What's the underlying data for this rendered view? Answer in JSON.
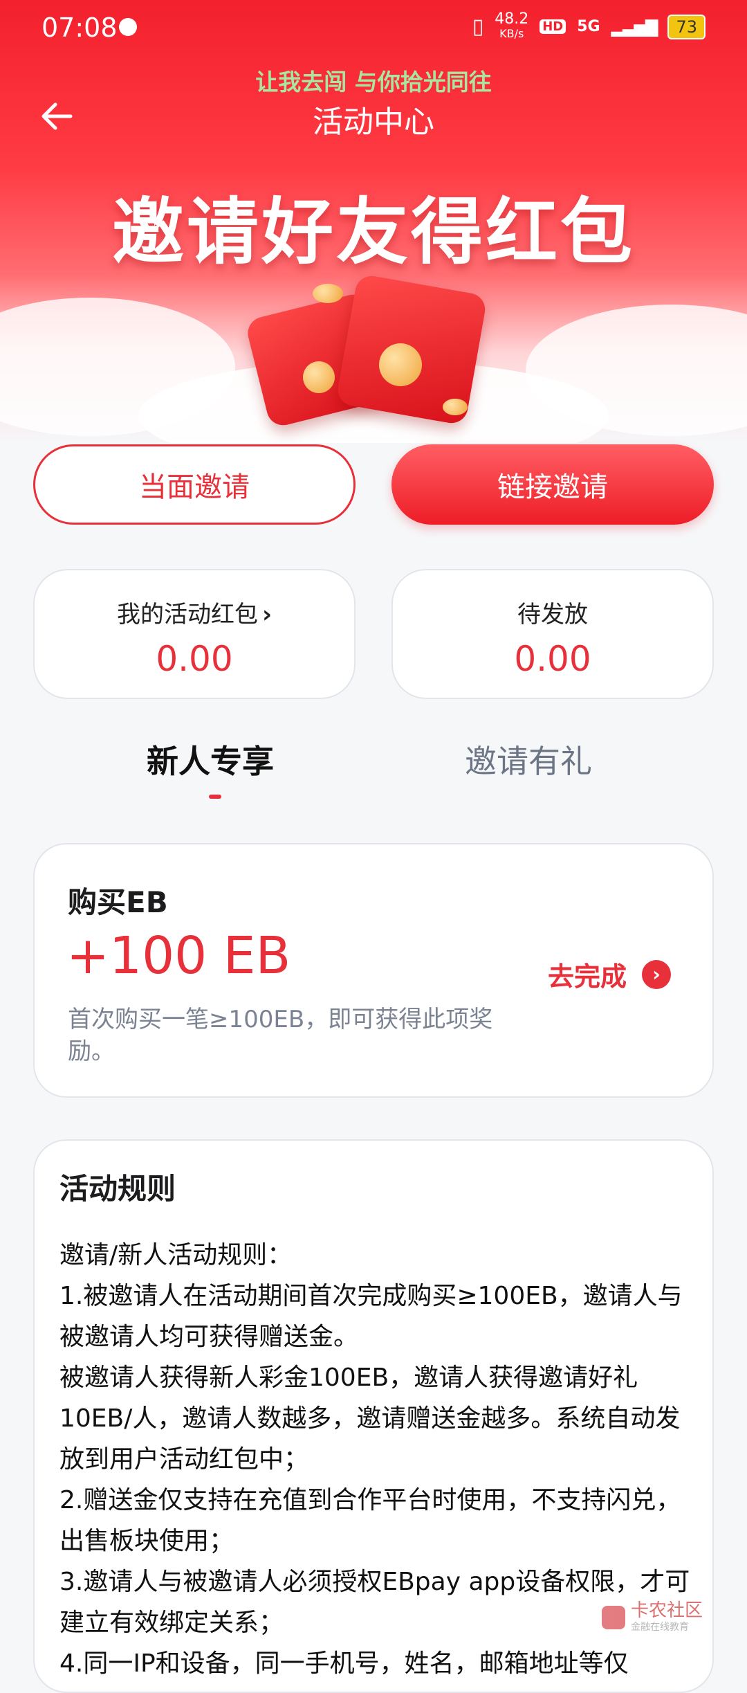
{
  "status_bar": {
    "time": "07:08",
    "net_speed": "48.2",
    "net_unit": "KB/s",
    "hd": "HD",
    "network": "5G",
    "battery": "73"
  },
  "nav": {
    "slogan": "让我去闯 与你拾光同往",
    "title": "活动中心"
  },
  "banner": {
    "title": "邀请好友得红包"
  },
  "invite_buttons": {
    "face_to_face": "当面邀请",
    "link": "链接邀请"
  },
  "stats": {
    "my_red_packet_label": "我的活动红包",
    "my_red_packet_value": "0.00",
    "pending_label": "待发放",
    "pending_value": "0.00"
  },
  "tabs": {
    "newcomer": "新人专享",
    "invite": "邀请有礼"
  },
  "task": {
    "title": "购买EB",
    "reward": "+100 EB",
    "description": "首次购买一笔≥100EB，即可获得此项奖励。",
    "action": "去完成"
  },
  "rules": {
    "title": "活动规则",
    "lines": [
      "邀请/新人活动规则：",
      "1.被邀请人在活动期间首次完成购买≥100EB，邀请人与被邀请人均可获得赠送金。",
      "被邀请人获得新人彩金100EB，邀请人获得邀请好礼10EB/人，邀请人数越多，邀请赠送金越多。系统自动发放到用户活动红包中；",
      "2.赠送金仅支持在充值到合作平台时使用，不支持闪兑，出售板块使用；",
      "3.邀请人与被邀请人必须授权EBpay app设备权限，才可建立有效绑定关系；",
      "4.同一IP和设备，同一手机号，姓名，邮箱地址等仅"
    ]
  },
  "watermark": {
    "text": "卡农社区",
    "sub": "金融在线教育"
  },
  "colors": {
    "accent": "#e8303a",
    "hero_red": "#f3202d",
    "slogan_green": "#a8e6a1"
  }
}
